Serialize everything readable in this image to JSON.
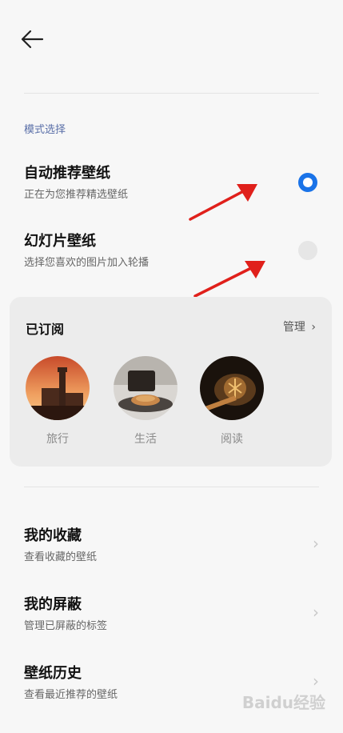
{
  "section": {
    "label": "模式选择"
  },
  "options": [
    {
      "title": "自动推荐壁纸",
      "subtitle": "正在为您推荐精选壁纸",
      "selected": true
    },
    {
      "title": "幻灯片壁纸",
      "subtitle": "选择您喜欢的图片加入轮播",
      "selected": false
    }
  ],
  "subscribed": {
    "title": "已订阅",
    "manage_label": "管理",
    "items": [
      {
        "label": "旅行",
        "icon": "travel-photo"
      },
      {
        "label": "生活",
        "icon": "coffee-photo"
      },
      {
        "label": "阅读",
        "icon": "reading-photo"
      }
    ]
  },
  "rows": [
    {
      "title": "我的收藏",
      "subtitle": "查看收藏的壁纸"
    },
    {
      "title": "我的屏蔽",
      "subtitle": "管理已屏蔽的标签"
    },
    {
      "title": "壁纸历史",
      "subtitle": "查看最近推荐的壁纸"
    }
  ],
  "colors": {
    "accent": "#1a73e8",
    "annotation_arrow": "#e0201b"
  },
  "watermark": "Baidu经验"
}
